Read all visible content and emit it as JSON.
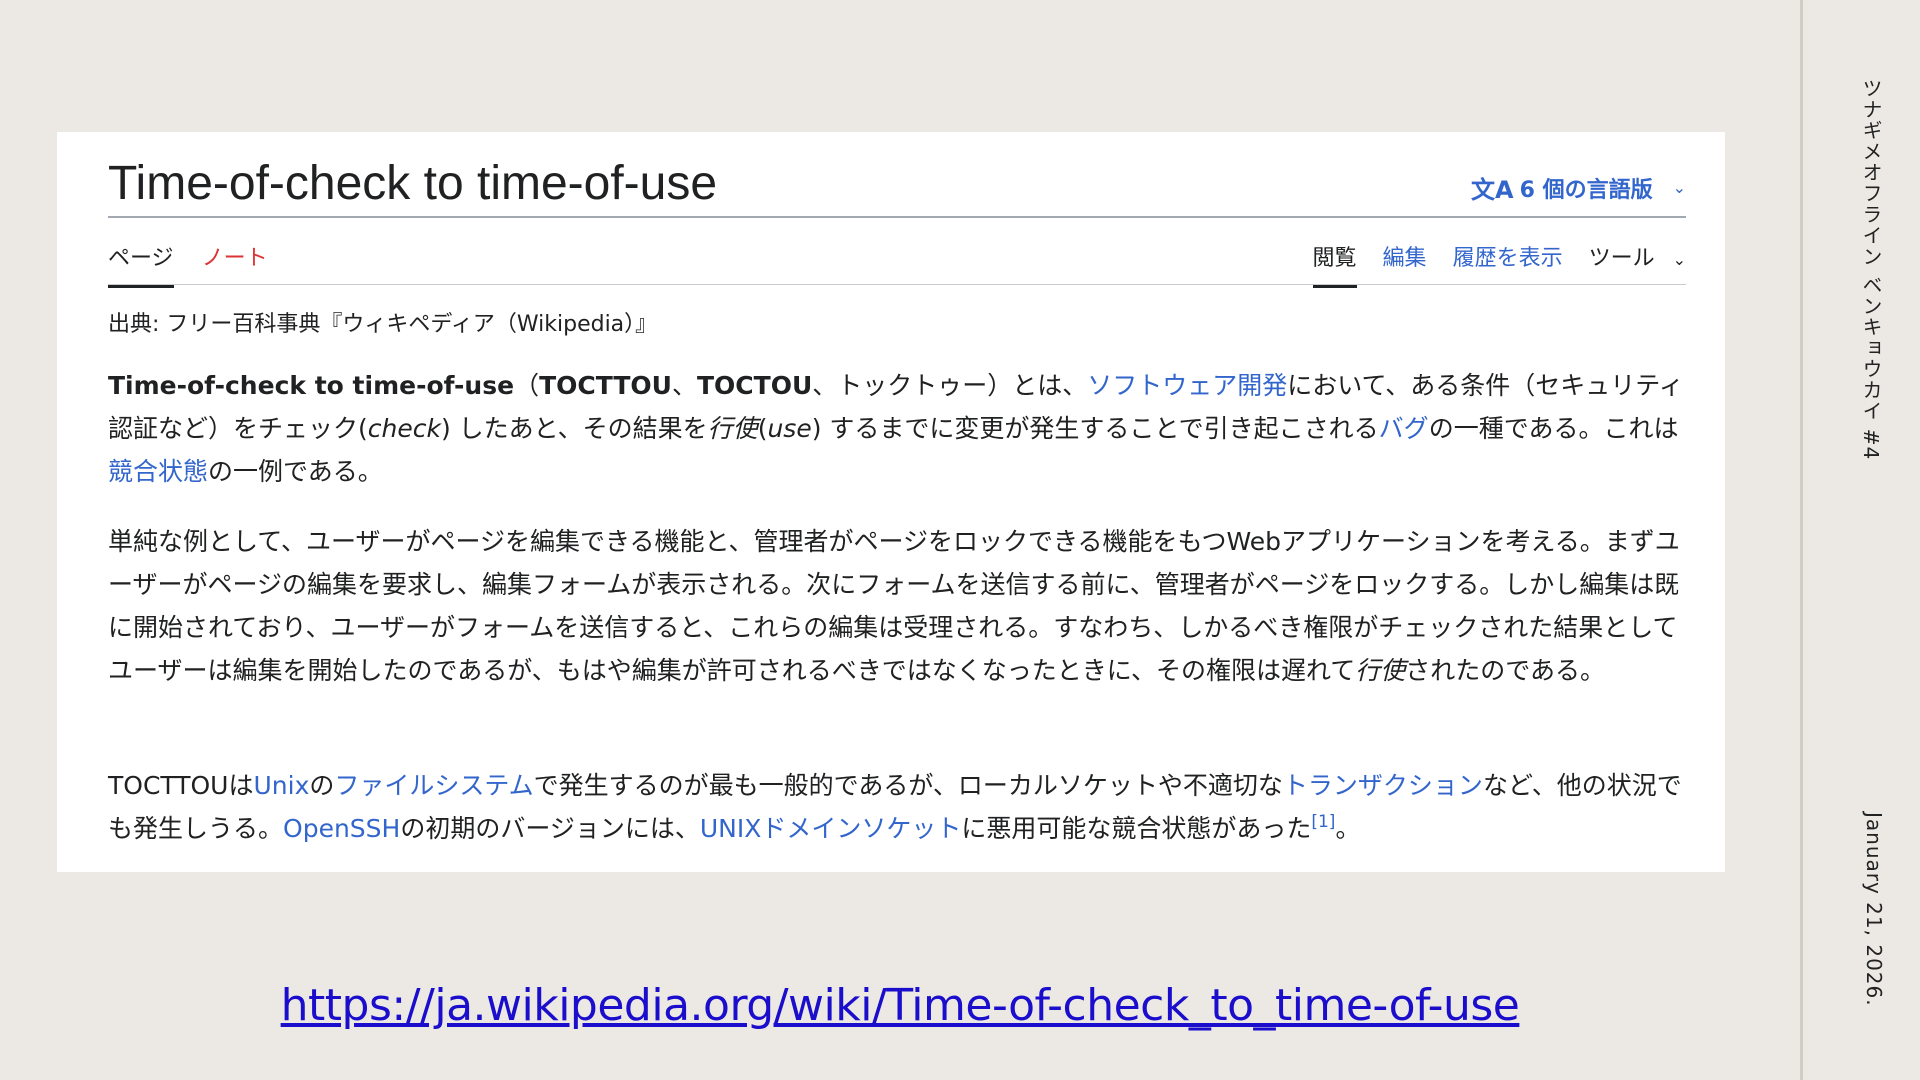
{
  "side": {
    "title": "ツナギメオフライン ベンキョウカイ #4",
    "date": "January 21, 2026."
  },
  "article": {
    "title": "Time-of-check to time-of-use",
    "language_count": "6 個の言語版",
    "language_icon": "translate-icon",
    "tabs_left": [
      "ページ",
      "ノート"
    ],
    "tabs_right": [
      "閲覧",
      "編集",
      "履歴を表示",
      "ツール"
    ],
    "source": "出典: フリー百科事典『ウィキペディア（Wikipedia）』",
    "p1": {
      "t1": "Time-of-check to time-of-use",
      "t2": "（",
      "t3": "TOCTTOU",
      "t4": "、",
      "t5": "TOCTOU",
      "t6": "、トックトゥー）とは、",
      "l1": "ソフトウェア開発",
      "t7": "において、ある条件（セキュリティ認証など）をチェック(",
      "i1": "check",
      "t8": ") したあと、その結果を",
      "i2": "行使",
      "t9": "(",
      "i3": "use",
      "t10": ") するまでに変更が発生することで引き起こされる",
      "l2": "バグ",
      "t11": "の一種である。これは",
      "l3": "競合状態",
      "t12": "の一例である。"
    },
    "p2": {
      "t1": "単純な例として、ユーザーがページを編集できる機能と、管理者がページをロックできる機能をもつWebアプリケーションを考える。まずユーザーがページの編集を要求し、編集フォームが表示される。次にフォームを送信する前に、管理者がページをロックする。しかし編集は既に開始されており、ユーザーがフォームを送信すると、これらの編集は受理される。すなわち、しかるべき権限がチェックされた結果としてユーザーは編集を開始したのであるが、もはや編集が許可されるべきではなくなったときに、その権限は遅れて",
      "i1": "行使",
      "t2": "されたのである。"
    },
    "p3": {
      "t1": "TOCTTOUは",
      "l1": "Unix",
      "t2": "の",
      "l2": "ファイルシステム",
      "t3": "で発生するのが最も一般的であるが、ローカルソケットや不適切な",
      "l3": "トランザクション",
      "t4": "など、他の状況でも発生しうる。",
      "l4": "OpenSSH",
      "t5": "の初期のバージョンには、",
      "l5": "UNIXドメインソケット",
      "t6": "に悪用可能な競合状態があった",
      "ref": "[1]",
      "t7": "。"
    }
  },
  "url": "https://ja.wikipedia.org/wiki/Time-of-check_to_time-of-use",
  "colors": {
    "background": "#ECE9E4",
    "link": "#3366CC",
    "talk_tab": "#DD3333",
    "url": "#1A0DCC"
  }
}
